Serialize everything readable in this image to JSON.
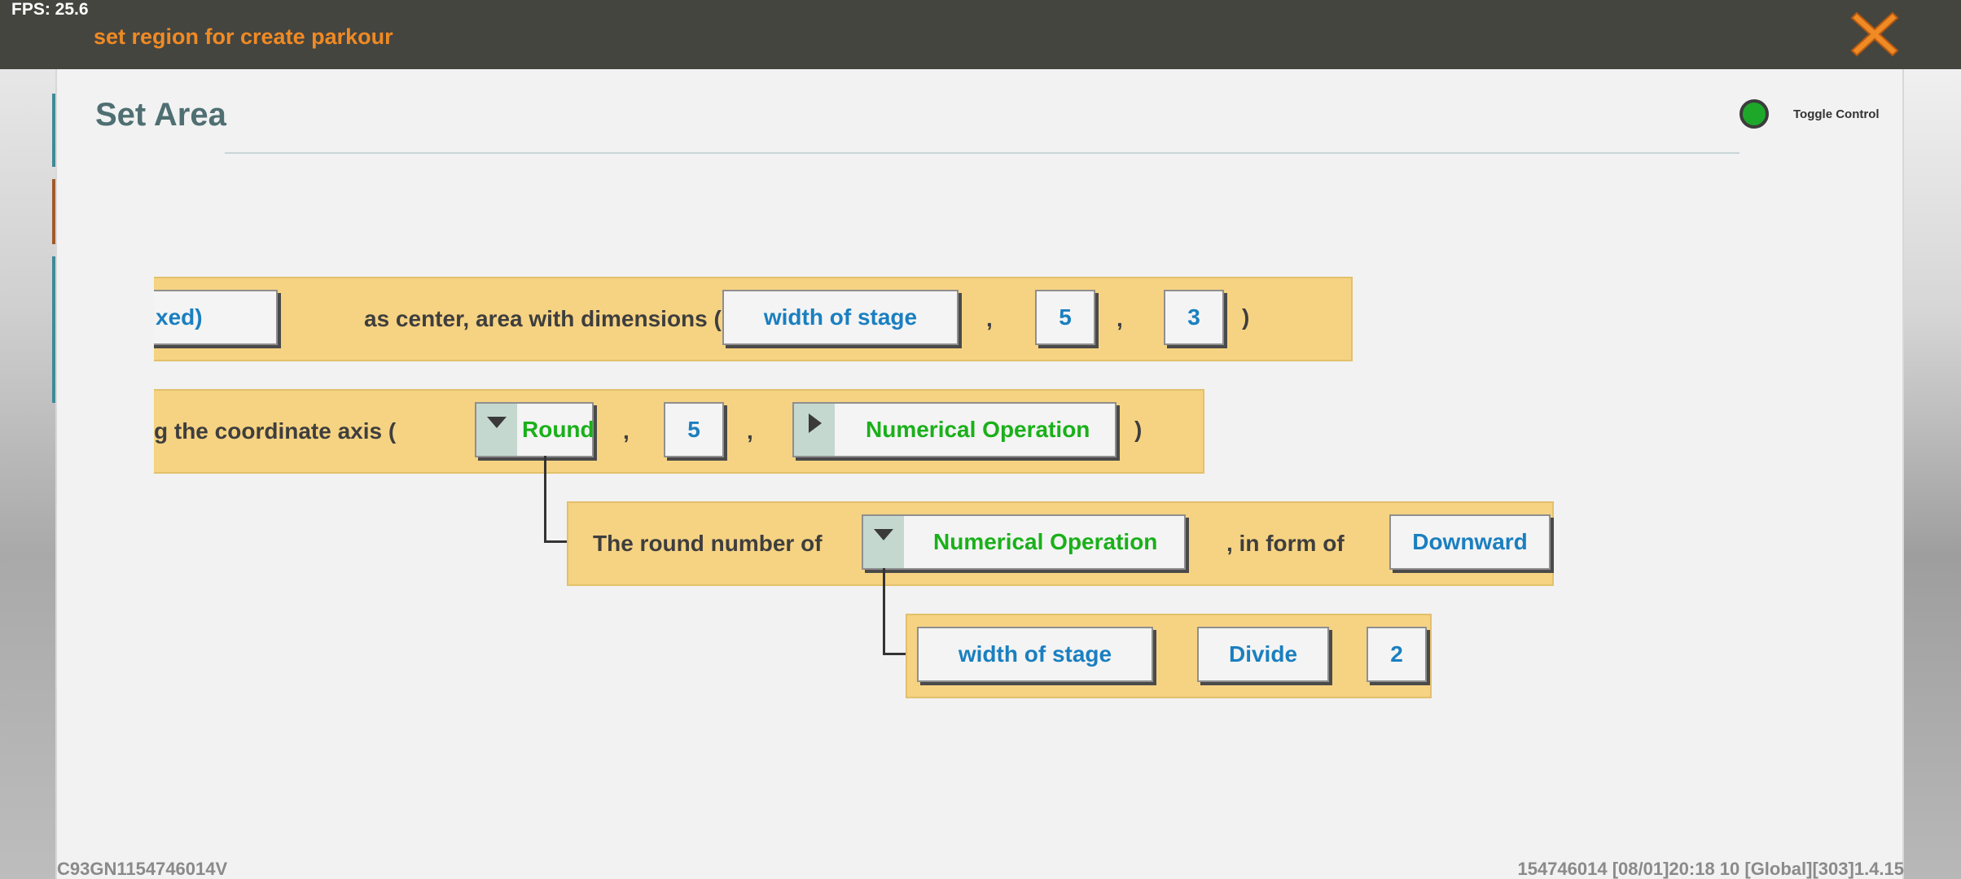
{
  "hud": {
    "fps": "FPS: 25.6"
  },
  "header": {
    "title": "set region for create parkour"
  },
  "panel": {
    "title": "Set Area",
    "toggle_label": "Toggle Control"
  },
  "row1": {
    "slot_partial": "xed)",
    "text1": "as center, area with dimensions (",
    "slot_width": "width of stage",
    "comma1": ",",
    "slot_5": "5",
    "comma2": ",",
    "slot_3": "3",
    "close": ")"
  },
  "row2": {
    "text1": "g the coordinate axis (",
    "slot_round": "Round",
    "comma1": ",",
    "slot_5": "5",
    "comma2": ",",
    "slot_numop": "Numerical Operation",
    "close": ")"
  },
  "row3": {
    "text1": "The round number of",
    "slot_numop": "Numerical Operation",
    "text2": ", in form of",
    "slot_downward": "Downward"
  },
  "row4": {
    "slot_width": "width of stage",
    "slot_divide": "Divide",
    "slot_2": "2"
  },
  "footer": {
    "left": "C93GN1154746014V",
    "right": "154746014   [08/01]20:18 10  [Global][303]1.4.15"
  },
  "colors": {
    "topbar": "#45453f",
    "title_orange": "#f08a24",
    "block_fill": "#f6d382",
    "value_blue": "#1a7fc0",
    "value_green": "#1ab01a",
    "toggle_green": "#1ea82a"
  }
}
